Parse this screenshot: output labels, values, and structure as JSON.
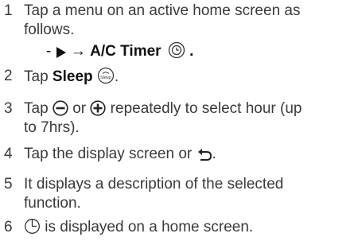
{
  "steps": [
    {
      "number": "1",
      "text_line1": "Tap a menu on an active home screen as",
      "text_line2": "follows.",
      "sub_prefix": "-",
      "sub_arrow": "→",
      "sub_label": "A/C Timer",
      "sub_suffix": "."
    },
    {
      "number": "2",
      "text_before": "Tap",
      "bold_label": "Sleep",
      "icon_caption": "Sleep",
      "text_after": "."
    },
    {
      "number": "3",
      "text_before": "Tap",
      "text_middle": "or",
      "text_after_line1": "repeatedly to select hour (up",
      "text_line2": "to 7hrs)."
    },
    {
      "number": "4",
      "text_before": "Tap the display screen or",
      "text_after": "."
    },
    {
      "number": "5",
      "text_line1": "It displays a description of the selected",
      "text_line2": "function."
    },
    {
      "number": "6",
      "text_after": "is displayed on a home screen."
    }
  ],
  "icons": {
    "play": "play-triangle-icon",
    "timer": "timer-icon",
    "sleep": "sleep-icon",
    "minus": "minus-circle-icon",
    "plus": "plus-circle-icon",
    "back": "back-arrow-icon",
    "clock": "timer-clock-icon"
  }
}
